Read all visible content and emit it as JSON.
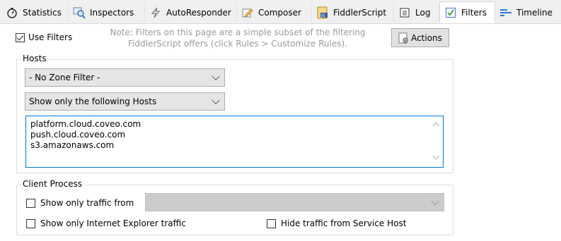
{
  "tabs": [
    {
      "label": "Statistics",
      "icon": "stopwatch-icon"
    },
    {
      "label": "Inspectors",
      "icon": "magnifier-icon"
    },
    {
      "label": "AutoResponder",
      "icon": "lightning-icon"
    },
    {
      "label": "Composer",
      "icon": "pencil-icon"
    },
    {
      "label": "FiddlerScript",
      "icon": "script-js-icon"
    },
    {
      "label": "Log",
      "icon": "log-icon"
    },
    {
      "label": "Filters",
      "icon": "checkbox-icon",
      "active": true
    },
    {
      "label": "Timeline",
      "icon": "timeline-icon"
    }
  ],
  "use_filters": {
    "label": "Use Filters",
    "checked": true
  },
  "note": {
    "line1": "Note: Filters on this page are a simple subset of the filtering",
    "line2": "FiddlerScript offers (click Rules > Customize Rules)."
  },
  "actions_button": {
    "label": "Actions"
  },
  "hosts": {
    "legend": "Hosts",
    "zone_filter": "- No Zone Filter -",
    "host_filter": "Show only the following Hosts",
    "host_list": [
      "platform.cloud.coveo.com",
      "push.cloud.coveo.com",
      "s3.amazonaws.com"
    ]
  },
  "client_process": {
    "legend": "Client Process",
    "only_traffic_from": {
      "label": "Show only traffic from",
      "checked": false
    },
    "only_ie": {
      "label": "Show only Internet Explorer traffic",
      "checked": false
    },
    "hide_service_host": {
      "label": "Hide traffic from Service Host",
      "checked": false
    }
  },
  "colors": {
    "accent": "#0078d7",
    "tab_bar": "#f0f0f0"
  }
}
